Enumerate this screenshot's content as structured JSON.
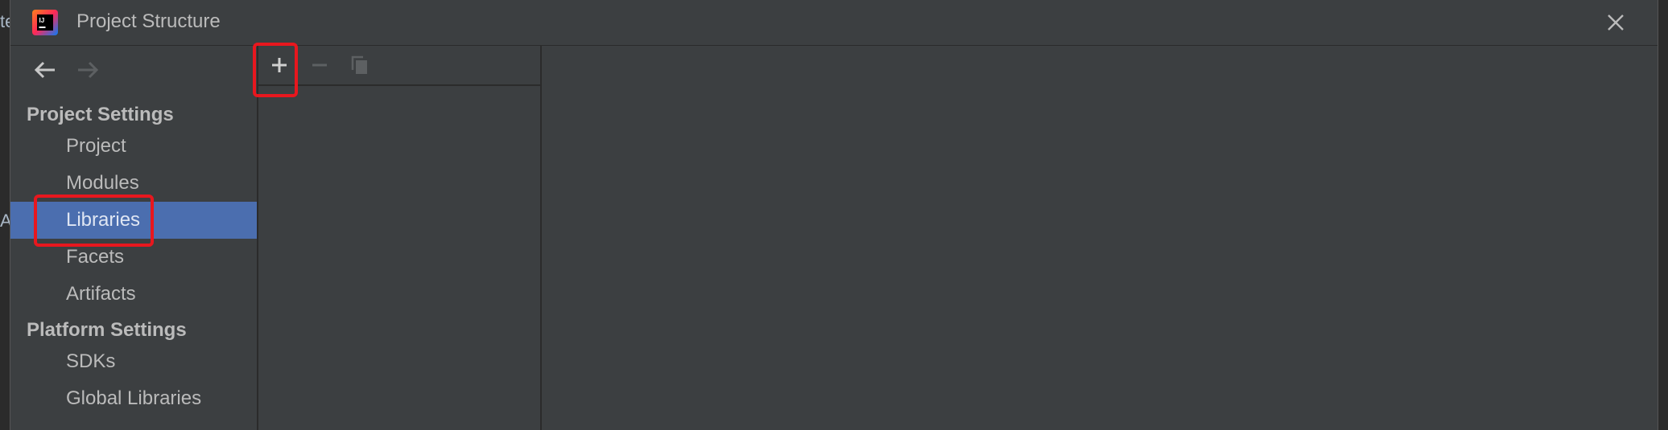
{
  "window": {
    "title": "Project Structure",
    "app_icon": "intellij-idea-icon",
    "close_icon": "close-icon"
  },
  "background": {
    "edge_text_1": "te",
    "edge_text_2": "At"
  },
  "navigation": {
    "back_icon": "arrow-left-icon",
    "forward_icon": "arrow-right-icon",
    "sections": [
      {
        "title": "Project Settings",
        "items": [
          "Project",
          "Modules",
          "Libraries",
          "Facets",
          "Artifacts"
        ]
      },
      {
        "title": "Platform Settings",
        "items": [
          "SDKs",
          "Global Libraries"
        ]
      }
    ],
    "selected_item": "Libraries"
  },
  "list_toolbar": {
    "add_icon": "plus-icon",
    "remove_icon": "minus-icon",
    "copy_icon": "copy-icon"
  },
  "colors": {
    "dialog_bg": "#3c3f41",
    "selection": "#4b6eaf",
    "text": "#bbbbbb",
    "highlight_annotation": "#e8171e"
  }
}
